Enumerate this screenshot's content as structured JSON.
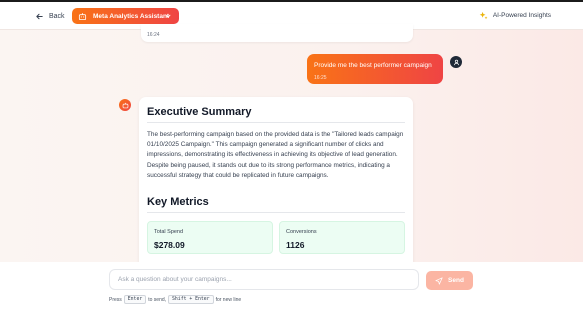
{
  "header": {
    "back_label": "Back",
    "assistant_label": "Meta Analytics Assistant",
    "insights_label": "AI-Powered Insights"
  },
  "conversation": {
    "previous_time": "16:24",
    "user_message": "Provide me the best performer campaign",
    "user_time": "16:25",
    "response": {
      "summary_title": "Executive Summary",
      "summary_text": "The best-performing campaign based on the provided data is the \"Tailored leads campaign 01/10/2025 Campaign.\" This campaign generated a significant number of clicks and impressions, demonstrating its effectiveness in achieving its objective of lead generation. Despite being paused, it stands out due to its strong performance metrics, indicating a successful strategy that could be replicated in future campaigns.",
      "metrics_title": "Key Metrics",
      "metrics": [
        {
          "label": "Total Spend",
          "value": "$278.09"
        },
        {
          "label": "Conversions",
          "value": "1126"
        }
      ]
    }
  },
  "composer": {
    "placeholder": "Ask a question about your campaigns...",
    "send_label": "Send",
    "hint_press": "Press",
    "hint_enter": "Enter",
    "hint_to_send": "to send,",
    "hint_shift_enter": "Shift + Enter",
    "hint_new_line": "for new line"
  },
  "colors": {
    "accent_start": "#f97316",
    "accent_end": "#ef4444",
    "metric_bg": "#ecfdf3"
  }
}
